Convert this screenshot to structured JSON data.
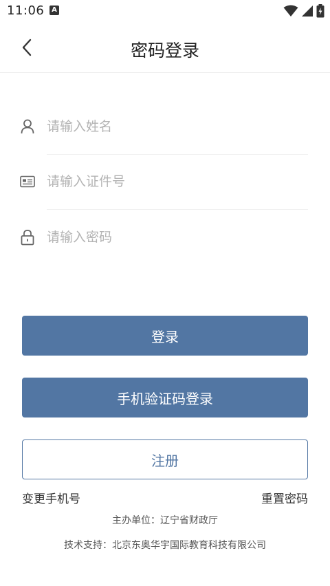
{
  "status": {
    "time": "11:06",
    "notif_letter": "A"
  },
  "header": {
    "title": "密码登录"
  },
  "form": {
    "name_placeholder": "请输入姓名",
    "id_placeholder": "请输入证件号",
    "password_placeholder": "请输入密码"
  },
  "buttons": {
    "login": "登录",
    "sms_login": "手机验证码登录",
    "register": "注册"
  },
  "links": {
    "change_phone": "变更手机号",
    "reset_password": "重置密码"
  },
  "footer": {
    "organizer": "主办单位：辽宁省财政厅",
    "support": "技术支持：北京东奥华宇国际教育科技有限公司"
  },
  "colors": {
    "primary": "#5276a3"
  }
}
